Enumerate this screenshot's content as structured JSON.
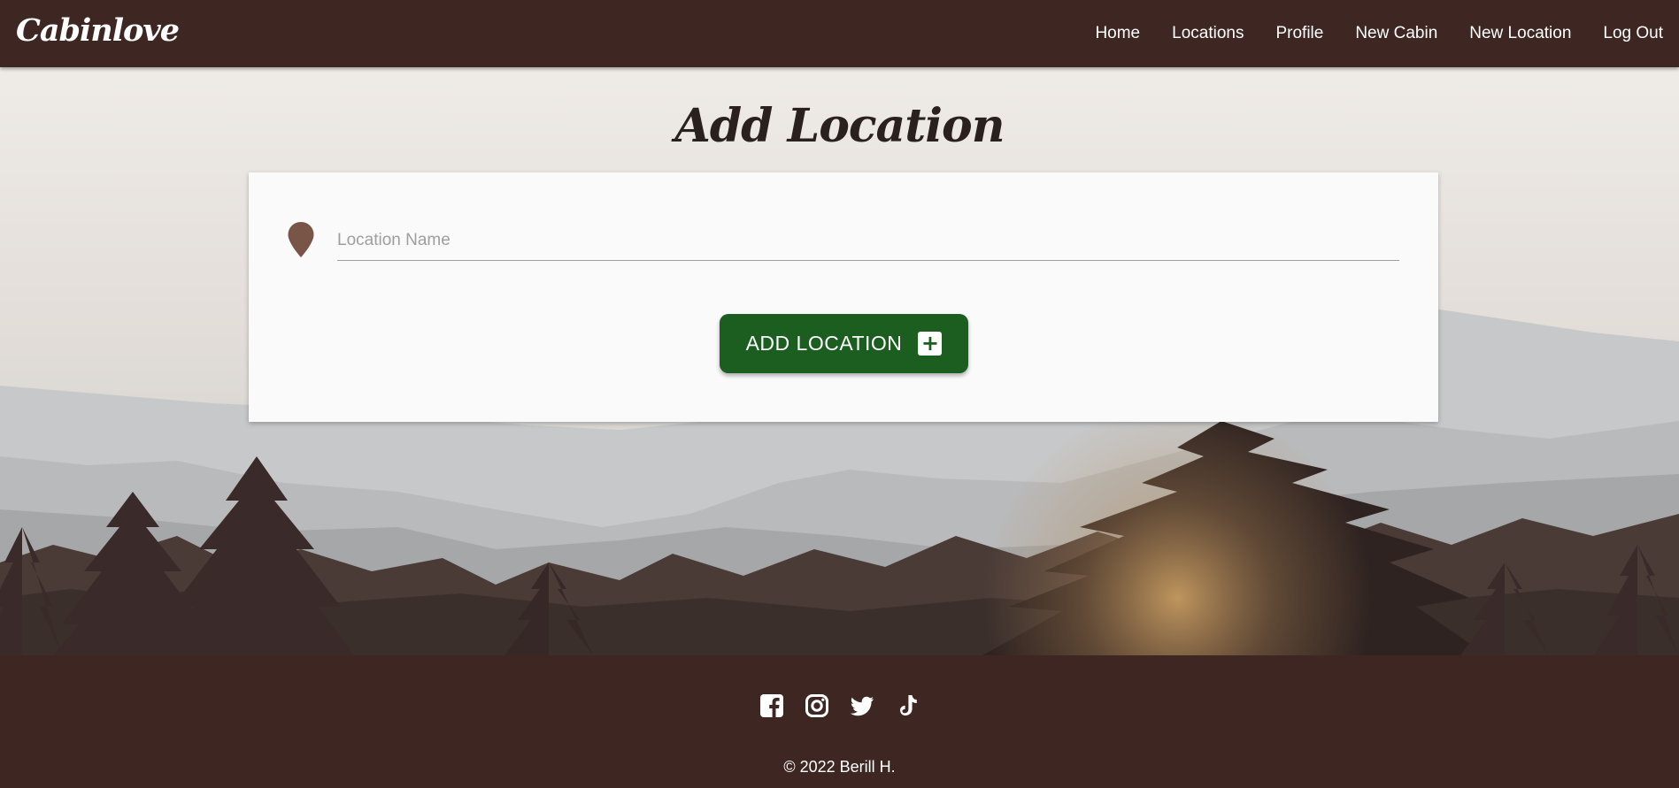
{
  "brand": {
    "name": "Cabinlove"
  },
  "nav": {
    "items": [
      {
        "label": "Home"
      },
      {
        "label": "Locations"
      },
      {
        "label": "Profile"
      },
      {
        "label": "New Cabin"
      },
      {
        "label": "New Location"
      },
      {
        "label": "Log Out"
      }
    ]
  },
  "page": {
    "title": "Add Location"
  },
  "form": {
    "location_input": {
      "placeholder": "Location Name",
      "value": "",
      "icon": "map-pin-icon"
    },
    "submit": {
      "label": "ADD LOCATION",
      "icon": "plus-square-icon"
    }
  },
  "footer": {
    "social": [
      {
        "icon": "facebook-icon"
      },
      {
        "icon": "instagram-icon"
      },
      {
        "icon": "twitter-icon"
      },
      {
        "icon": "tiktok-icon"
      }
    ],
    "copyright": "© 2022 Berill H."
  },
  "colors": {
    "nav_bg": "#3e2723",
    "button_bg": "#1b5e20",
    "pin": "#795548",
    "card_bg": "#fafafa"
  }
}
